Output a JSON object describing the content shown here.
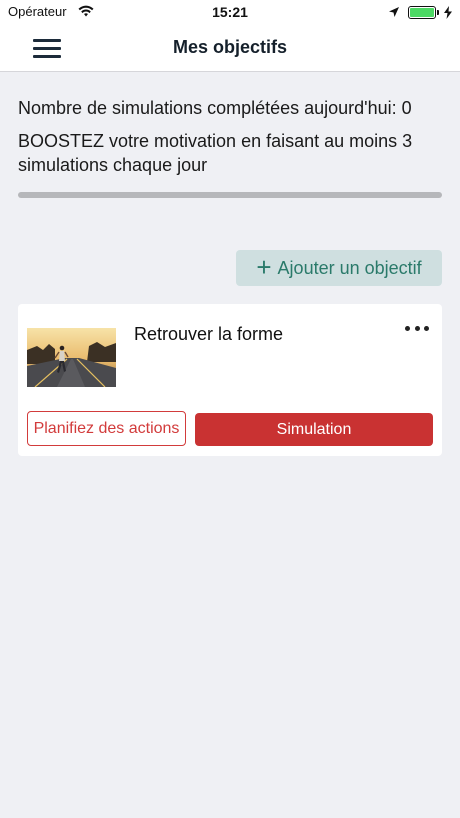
{
  "status_bar": {
    "carrier": "Opérateur",
    "time": "15:21",
    "battery_level": 1.0,
    "wifi_icon": "wifi-icon",
    "location_icon": "location-arrow-icon",
    "charging_icon": "bolt-icon"
  },
  "nav": {
    "title": "Mes objectifs",
    "menu_icon": "hamburger-menu-icon"
  },
  "stats": {
    "completed_label": "Nombre de simulations complétées aujourd'hui: 0",
    "motivation": "BOOSTEZ votre motivation en faisant au moins 3 simulations chaque jour",
    "progress": 0
  },
  "actions": {
    "add_goal_label": "Ajouter un objectif",
    "add_icon": "plus-icon"
  },
  "goals": [
    {
      "title": "Retrouver la forme",
      "image": "runner-on-road-photo",
      "more_icon": "more-horizontal-icon",
      "plan_label": "Planifiez des actions",
      "simulation_label": "Simulation"
    }
  ],
  "colors": {
    "background": "#eff0f4",
    "accent": "#2a7a6a",
    "add_button_bg": "#cfdfe0",
    "danger": "#c93232"
  }
}
